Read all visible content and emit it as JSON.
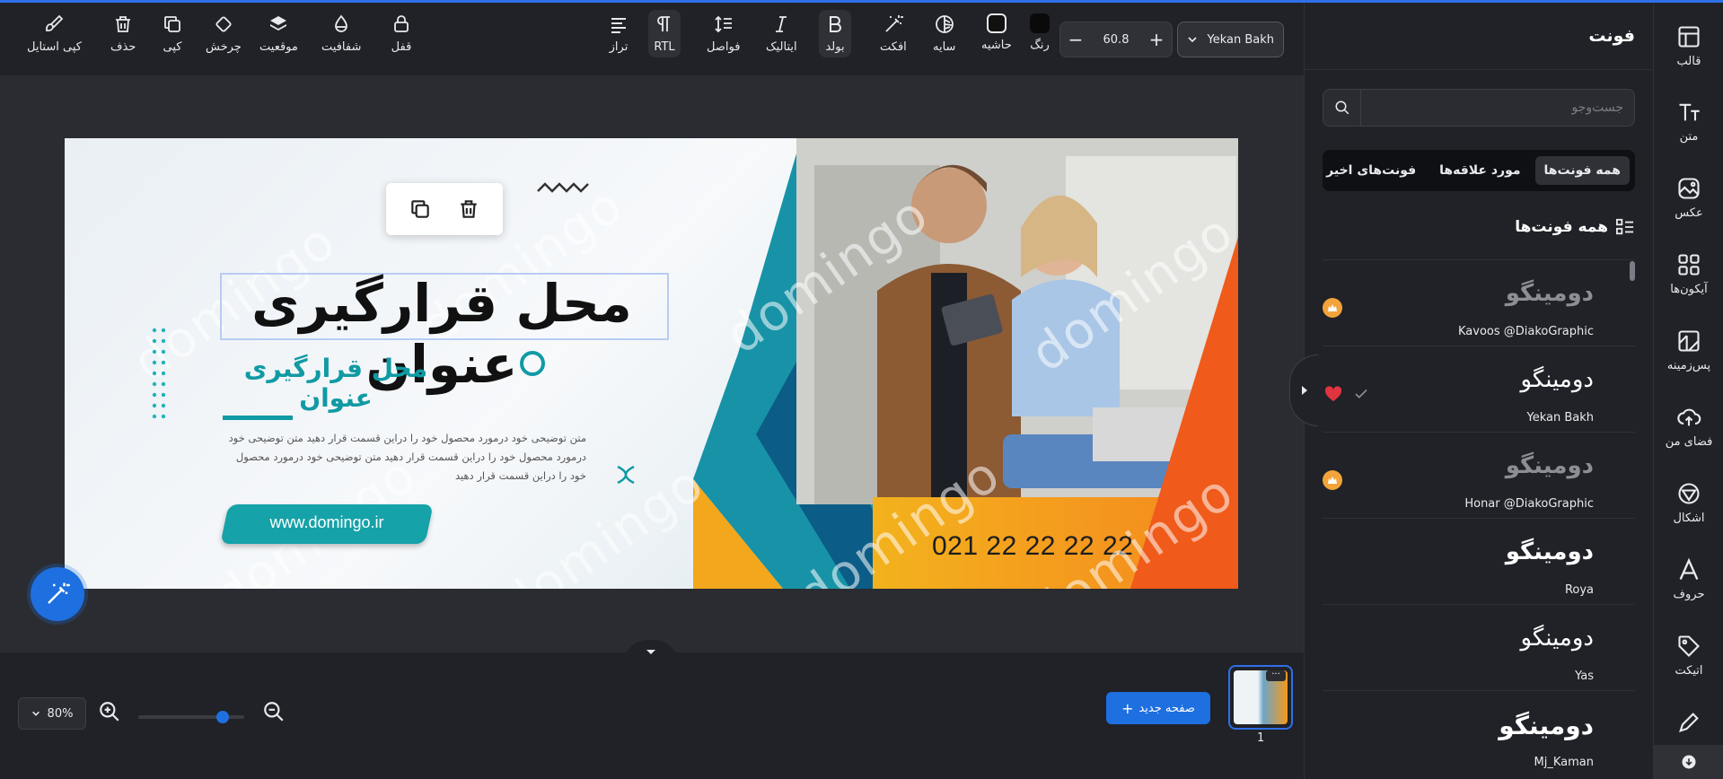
{
  "toolbar": {
    "copy_style": "کپی استایل",
    "delete": "حذف",
    "copy": "کپی",
    "rotate": "چرخش",
    "position": "موقعیت",
    "opacity": "شفافیت",
    "lock": "قفل",
    "align": "تراز",
    "rtl": "RTL",
    "spacing": "فواصل",
    "italic": "ایتالیک",
    "bold": "بولد",
    "effect": "افکت",
    "shadow": "سایه",
    "border": "حاشیه",
    "color": "رنگ",
    "font_size": "60.8",
    "font_name": "Yekan Bakh",
    "text_color": "#111111"
  },
  "canvas": {
    "title_main": "محل قرارگیری عنوان",
    "title_sub": "محل قرارگیری عنوان",
    "description": "متن توضیحی خود درمورد محصول خود را دراین قسمت قرار دهید متن توضیحی خود درمورد محصول خود را دراین قسمت قرار دهید متن توضیحی خود درمورد محصول خود را دراین قسمت قرار دهید",
    "url": "www.domingo.ir",
    "phone": "021 22 22 22 22",
    "watermark": "domingo",
    "accent": "#109aa4",
    "orange": "#f5871f"
  },
  "bottom": {
    "zoom": "80%",
    "new_page": "صفحه جدید",
    "page_number": "1",
    "thumb_menu": "···",
    "zoom_level": 0.8
  },
  "panel": {
    "title": "فونت",
    "search_placeholder": "جست‌وجو",
    "tabs": [
      "همه فونت‌ها",
      "مورد علاقه‌ها",
      "فونت‌های اخیر"
    ],
    "section_title": "همه فونت‌ها",
    "fonts": [
      {
        "preview": "دومینگو",
        "name": "Kavoos @DiakoGraphic",
        "premium": true,
        "muted": true
      },
      {
        "preview": "دومینگو",
        "name": "Yekan Bakh",
        "favorite": true,
        "selected": true
      },
      {
        "preview": "دومینگو",
        "name": "Honar @DiakoGraphic",
        "premium": true,
        "muted": true
      },
      {
        "preview": "دومینگو",
        "name": "Roya"
      },
      {
        "preview": "دومینگو",
        "name": "Yas"
      },
      {
        "preview": "دومینگو",
        "name": "Mj_Kaman"
      }
    ]
  },
  "rail": {
    "items": [
      "قالب",
      "متن",
      "عکس",
      "آیکون‌ها",
      "پس‌زمینه",
      "فضای من",
      "اشکال",
      "حروف",
      "اتیکت"
    ]
  },
  "colors": {
    "brand_blue": "#1e6fe0",
    "panel_bg": "#202227",
    "canvas_bg": "#2a2c31",
    "premium_badge": "#f2a43a",
    "heart": "#e0343f"
  }
}
